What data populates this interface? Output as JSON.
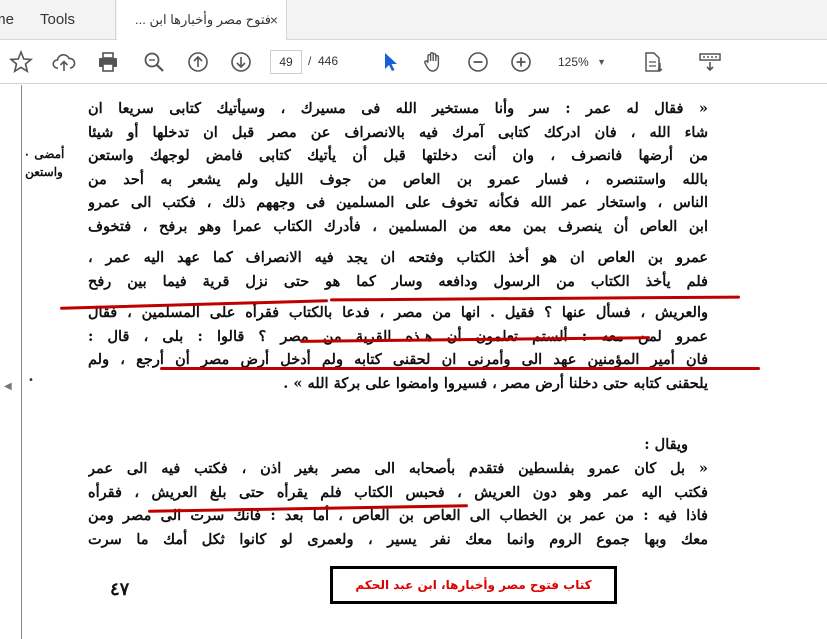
{
  "tabs": {
    "home_label": "Home",
    "tools_label": "Tools",
    "document_title": "فتوح مصر وأخبارها ابن ...",
    "close_glyph": "×"
  },
  "toolbar": {
    "icons": [
      "star-icon",
      "upload-cloud-icon",
      "print-icon",
      "zoom-search-icon",
      "page-up-icon",
      "page-down-icon",
      "select-cursor-icon",
      "hand-icon",
      "zoom-out-icon",
      "zoom-in-icon",
      "fit-page-icon",
      "read-mode-icon"
    ],
    "current_page": "49",
    "page_separator": "/",
    "total_pages": "446",
    "zoom_level": "125%"
  },
  "document": {
    "margin_note": [
      "أمضى ٠",
      "واستعن"
    ],
    "para1_lines": [
      "« فقال له عمر : سر وأنا مستخير الله فى مسيرك ، وسيأتيك كتابى سريعا ان",
      "شاء الله ، فان ادركك كتابى آمرك فيه بالانصراف عن مصر قبل ان تدخلها أو شيئا",
      "من أرضها فانصرف ، وان أنت دخلتها قبل أن يأتيك كتابى فامض لوجهك واستعن",
      "بالله واستنصره ، فسار عمرو بن العاص من جوف الليل ولم يشعر به أحد من",
      "الناس ، واستخار عمر الله فكأنه تخوف على المسلمين فى وجههم ذلك ، فكتب الى عمرو",
      "ابن العاص أن ينصرف بمن معه من المسلمين ، فأدرك الكتاب عمرا وهو برفح ، فتخوف",
      "عمرو بن العاص ان هو أخذ الكتاب وفتحه ان يجد فيه الانصراف كما عهد اليه عمر ،",
      "فلم يأخذ الكتاب من الرسول ودافعه وسار كما هو حتى نزل قرية فيما بين رفح",
      "والعريش ، فسأل عنها ؟ فقيل . انها من مصر ، فدعا بالكتاب فقرأه على المسلمين ، فقال",
      "عمرو لمن معه : ألستم تعلمون أن هـذه القرية من مصر ؟ قالوا : بلى ، قال :",
      "فان أمير المؤمنين عهد الى وأمرنى ان لحقنى كتابه ولم أدخل أرض مصر أن أرجع ، ولم",
      "يلحقنى كتابه حتى دخلنا أرض مصر ، فسيروا وامضوا على بركة الله » ."
    ],
    "para2_heading": "ويقال :",
    "para3_lines": [
      "« بل كان عمرو بفلسطين فتقدم بأصحابه الى مصر بغير اذن ، فكتب فيه الى عمر",
      "فكتب اليه عمر وهو دون العريش ، فحبس الكتاب فلم يقرأه حتى بلغ العريش ، فقرأه",
      "فاذا فيه : من عمر بن الخطاب الى العاص بن العاص ، أما بعد : فانك سرت الى مصر ومن",
      "معك وبها جموع الروم وانما معك نفر يسير ، ولعمرى لو كانوا ثكل أمك ما سرت"
    ],
    "page_number": "٤٧",
    "caption": "كتاب فتوح مصر وأخبارها، ابن عبد الحكم"
  },
  "colors": {
    "annotation_underline": "#c00000",
    "caption_text": "#e00000",
    "select_tool_active": "#1a5fd6"
  }
}
